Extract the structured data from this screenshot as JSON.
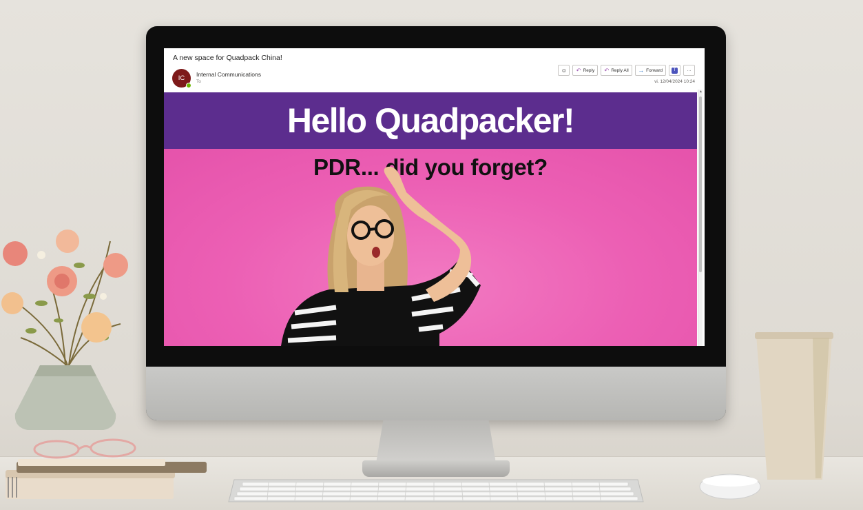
{
  "email": {
    "subject": "A new space for Quadpack China!",
    "sender_initials": "IC",
    "sender_name": "Internal Communications",
    "to_label": "To",
    "timestamp": "vi. 12/04/2024 10:24",
    "actions": {
      "reply": "Reply",
      "reply_all": "Reply All",
      "forward": "Forward",
      "more": "···"
    }
  },
  "banner": {
    "headline": "Hello Quadpacker!",
    "subheadline": "PDR...   did you forget?"
  },
  "colors": {
    "banner_purple": "#5c2d8e",
    "banner_pink": "#ef64b9",
    "avatar_red": "#7d1a1a",
    "presence_green": "#6bb700"
  },
  "icons": [
    "emoji-icon",
    "reply-icon",
    "reply-all-icon",
    "forward-icon",
    "teams-icon",
    "more-icon",
    "scroll-up-icon"
  ]
}
